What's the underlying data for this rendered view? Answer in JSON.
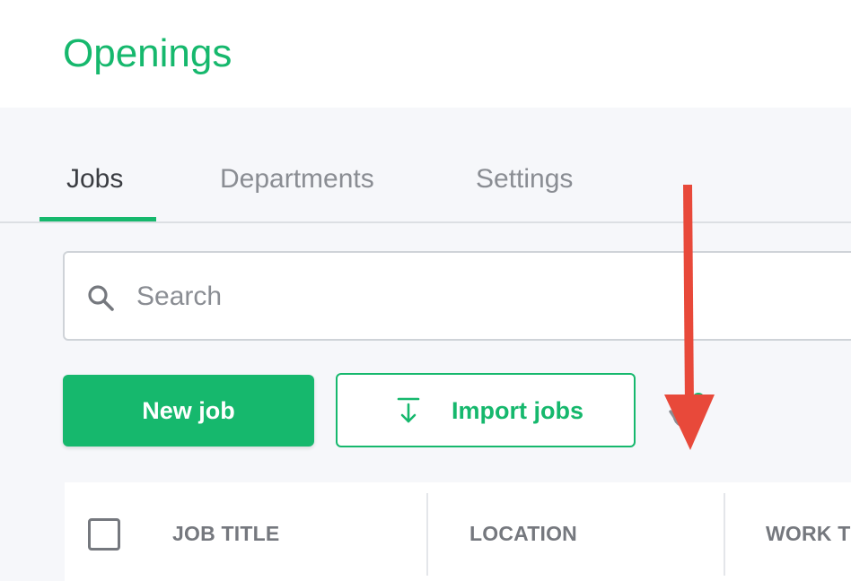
{
  "header": {
    "title": "Openings"
  },
  "tabs": [
    {
      "label": "Jobs",
      "active": true
    },
    {
      "label": "Departments",
      "active": false
    },
    {
      "label": "Settings",
      "active": false
    }
  ],
  "search": {
    "placeholder": "Search",
    "value": "",
    "icon": "search-icon"
  },
  "actions": {
    "new_job_label": "New job",
    "import_jobs_label": "Import jobs",
    "import_icon": "download-icon",
    "history_icon": "history-check-icon"
  },
  "table": {
    "columns": [
      "JOB TITLE",
      "LOCATION",
      "WORK TYPE"
    ]
  },
  "annotation": {
    "type": "red-arrow",
    "target": "history-button"
  },
  "colors": {
    "accent": "#16b86d",
    "annotation": "#e8493a",
    "background": "#f6f7fa",
    "text_muted": "#8a8d93"
  }
}
